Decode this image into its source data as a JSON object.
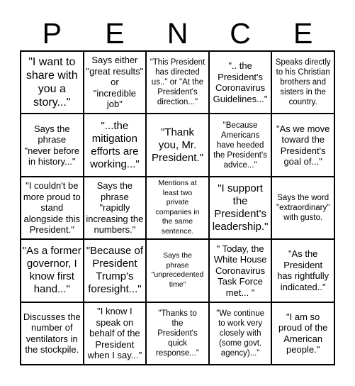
{
  "title_letters": [
    "P",
    "E",
    "N",
    "C",
    "E"
  ],
  "colors": {
    "grid_line": "#000000",
    "cell_background": "#ffffff",
    "text": "#000000"
  },
  "cells": [
    [
      "\"I want to\nshare with\nyou a\nstory...\"",
      "Says either\n\"great results\"\nor\n\"incredible\njob\"",
      "\"This President\nhas directed\nus..\" or \"At the\nPresident's\ndirection...\"",
      "\".. the\nPresident's\nCoronavirus\nGuidelines...\"",
      "Speaks directly\nto his Christian\nbrothers and\nsisters in the\ncountry."
    ],
    [
      "Says the\nphrase\n\"never before\nin history...\"",
      "\"...the\nmitigation\nefforts are\nworking...\"",
      "\"Thank\nyou, Mr.\nPresident.\"",
      "\"Because\nAmericans\nhave heeded\nthe President's\nadvice...\"",
      "\"As we move\ntoward the\nPresident's\ngoal of...\""
    ],
    [
      "\"I couldn't be\nmore proud to\nstand\nalongside this\nPresident.\"",
      "Says the\nphrase\n\"rapidly\nincreasing the\nnumbers.\"",
      "Mentions at\nleast two\nprivate\ncompanies in\nthe same\nsentence.",
      "\"I support\nthe\nPresident's\nleadership.\"",
      "Says the word\n\"extraordinary\"\nwith gusto."
    ],
    [
      "\"As a former\ngovernor, I\nknow first\nhand...\"",
      "\"Because of\nPresident\nTrump's\nforesight...\"",
      "Says the\nphrase\n\"unprecedented\ntime\"",
      "\" Today, the\nWhite House\nCoronavirus\nTask Force\nmet... \"",
      "\"As the\nPresident\nhas rightfully\nindicated..\""
    ],
    [
      "Discusses the\nnumber of\nventilators in\nthe stockpile.",
      "\"I know I\nspeak on\nbehalf of the\nPresident\nwhen I say...\"",
      "\"Thanks to\nthe\nPresident's\nquick\nresponse...\"",
      "\"We continue\nto work very\nclosely with\n(some govt.\nagency)...\"",
      "\"I am so\nproud of the\nAmerican\npeople.\""
    ]
  ]
}
